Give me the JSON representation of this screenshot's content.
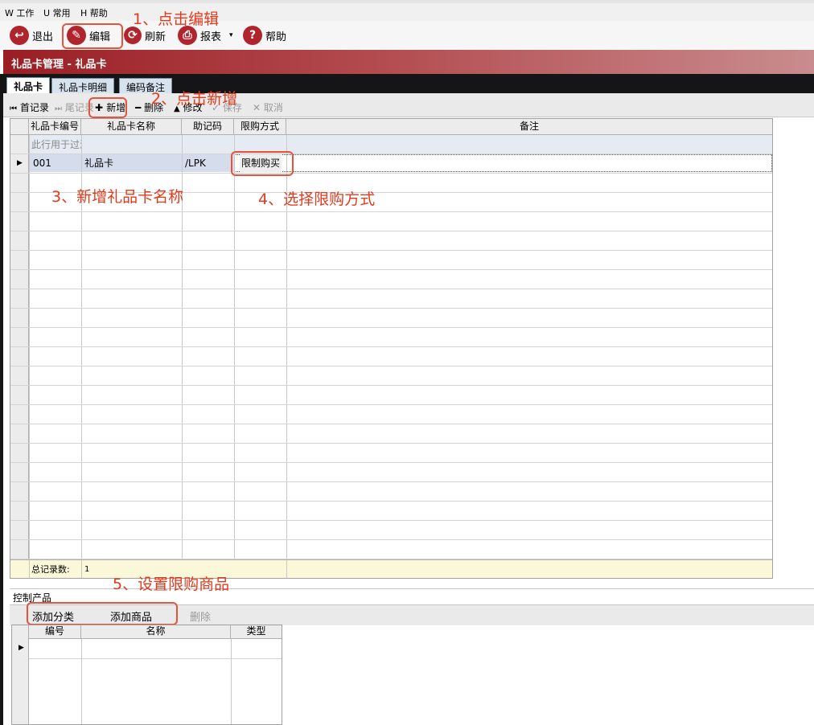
{
  "menu": [
    {
      "key": "W",
      "label": "工作"
    },
    {
      "key": "U",
      "label": "常用"
    },
    {
      "key": "H",
      "label": "帮助"
    }
  ],
  "toolbar": {
    "exit": "退出",
    "edit": "编辑",
    "refresh": "刷新",
    "report": "报表",
    "help": "帮助"
  },
  "title": "礼品卡管理 - 礼品卡",
  "tabs": [
    "礼品卡",
    "礼品卡明细",
    "编码备注"
  ],
  "nav": {
    "first": "首记录",
    "last": "尾记录",
    "add": "新增",
    "delete": "删除",
    "modify": "修改",
    "save": "保存",
    "cancel": "取消"
  },
  "grid": {
    "columns": [
      "礼品卡编号",
      "礼品卡名称",
      "助记码",
      "限购方式",
      "备注"
    ],
    "filter_hint": "此行用于过滤",
    "rows": [
      {
        "code": "001",
        "name": "礼品卡",
        "mnemonic": "/LPK",
        "limit": "限制购买",
        "note": ""
      }
    ],
    "footer_label": "总记录数:",
    "footer_count": "1"
  },
  "control": {
    "label": "控制产品",
    "add_category": "添加分类",
    "add_product": "添加商品",
    "delete": "删除",
    "columns": [
      "编号",
      "名称",
      "类型"
    ]
  },
  "annotations": {
    "a1": "1、点击编辑",
    "a2": "2、点击新增",
    "a3": "3、新增礼品卡名称",
    "a4": "4、选择限购方式",
    "a5": "5、设置限购商品"
  },
  "colors": {
    "accent": "#b0252d",
    "annotation": "#e23a1d"
  }
}
